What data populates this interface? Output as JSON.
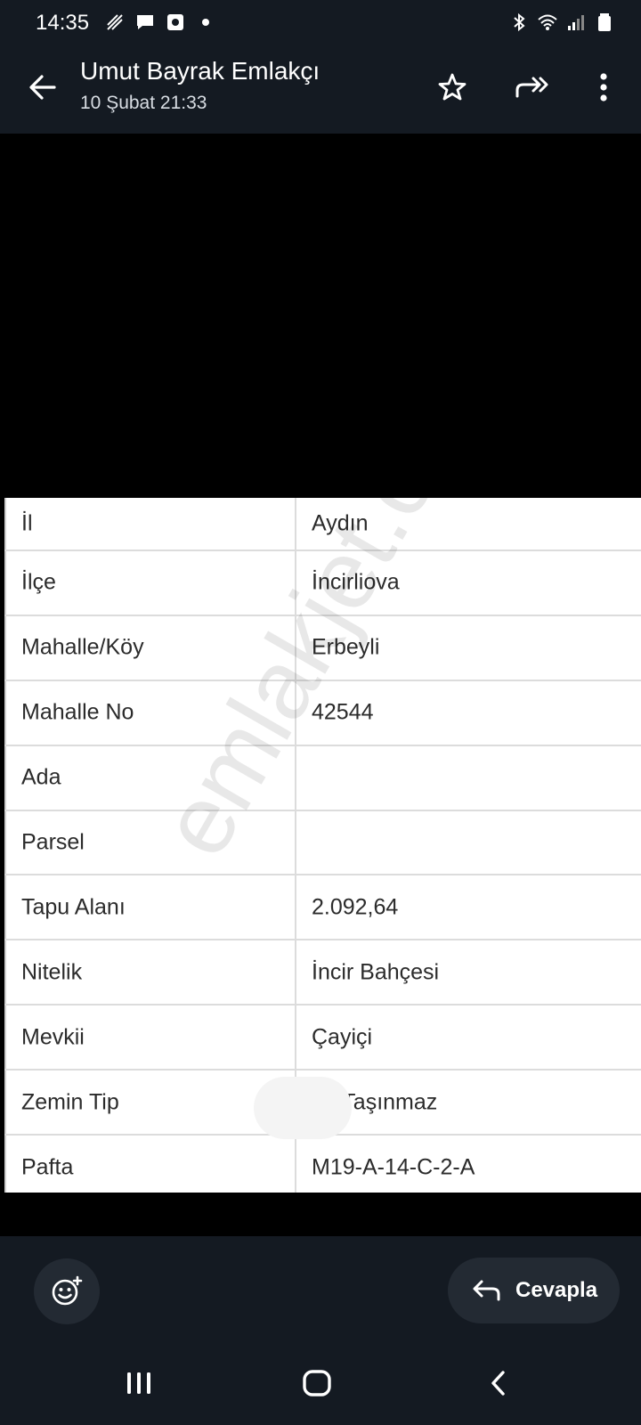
{
  "status_bar": {
    "time": "14:35",
    "left_icons": [
      "notification-off-icon",
      "chat-icon",
      "app-icon",
      "dot-icon"
    ],
    "right_icons": [
      "bluetooth-icon",
      "wifi-icon",
      "signal-icon",
      "battery-icon"
    ]
  },
  "app_bar": {
    "title": "Umut Bayrak Emlakçı",
    "subtitle": "10 Şubat 21:33",
    "icons": [
      "back-arrow-icon",
      "star-icon",
      "forward-icon",
      "more-vert-icon"
    ]
  },
  "image": {
    "watermark": "emlakjet.com",
    "rows": [
      {
        "label": "İl",
        "value": "Aydın"
      },
      {
        "label": "İlçe",
        "value": "İncirliova"
      },
      {
        "label": "Mahalle/Köy",
        "value": "Erbeyli"
      },
      {
        "label": "Mahalle No",
        "value": "42544"
      },
      {
        "label": "Ada",
        "value": ""
      },
      {
        "label": "Parsel",
        "value": ""
      },
      {
        "label": "Tapu Alanı",
        "value": "2.092,64"
      },
      {
        "label": "Nitelik",
        "value": "İncir Bahçesi"
      },
      {
        "label": "Mevkii",
        "value": "Çayiçi"
      },
      {
        "label": "Zemin Tip",
        "value": "na Taşınmaz"
      },
      {
        "label": "Pafta",
        "value": "M19-A-14-C-2-A"
      }
    ]
  },
  "bottom_bar": {
    "reply_label": "Cevapla",
    "icons": [
      "emoji-add-icon",
      "reply-icon"
    ]
  },
  "nav_bar": {
    "icons": [
      "recents-icon",
      "home-icon",
      "nav-back-icon"
    ]
  },
  "colors": {
    "bar_background": "#141a22",
    "button_background": "#232a33",
    "viewer_background": "#000000",
    "table_text": "#2b2b2b"
  }
}
